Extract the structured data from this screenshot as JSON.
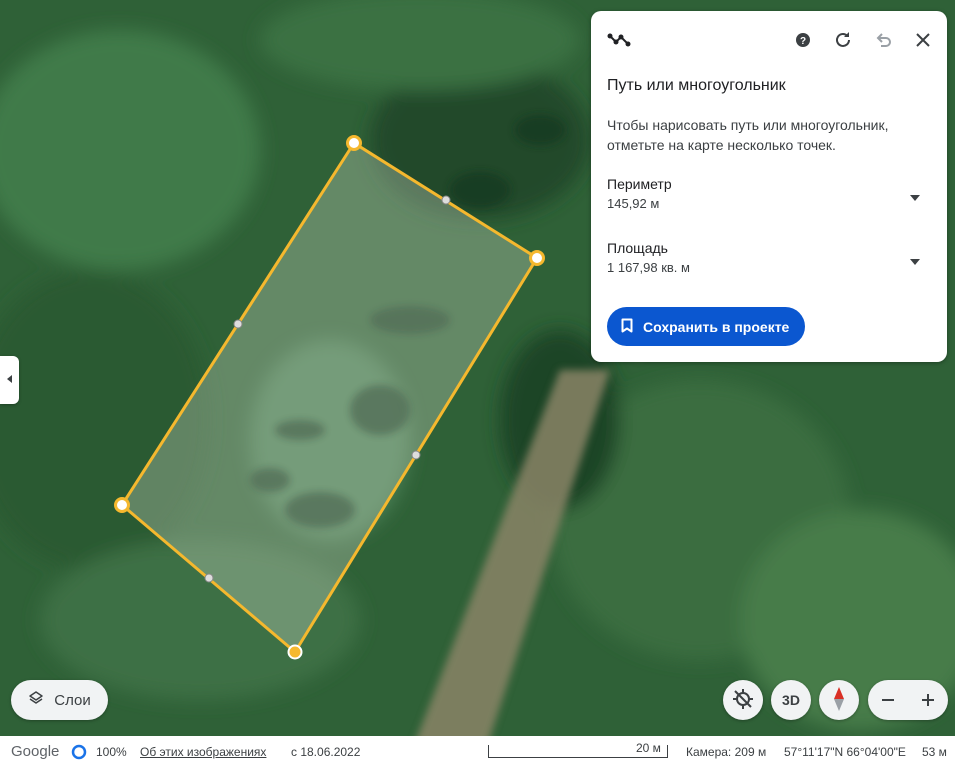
{
  "panel": {
    "title": "Путь или многоугольник",
    "hint": "Чтобы нарисовать путь или многоугольник, отметьте на карте несколько точек.",
    "perimeter": {
      "label": "Периметр",
      "value": "145,92 м"
    },
    "area": {
      "label": "Площадь",
      "value": "1 167,98 кв. м"
    },
    "save_label": "Сохранить в проекте",
    "icons": [
      "path-tool-icon",
      "help-icon",
      "refresh-icon",
      "undo-icon",
      "close-icon"
    ]
  },
  "controls": {
    "layers_label": "Слои",
    "three_d_label": "3D"
  },
  "status": {
    "logo": "Google",
    "zoom": "100%",
    "about_link": "Об этих изображениях",
    "date": "с 18.06.2022",
    "scale": "20 м",
    "camera": "Камера: 209 м",
    "coords": "57°11'17\"N 66°04'00\"E",
    "elevation": "53 м"
  },
  "colors": {
    "accent": "#0b57d0",
    "polygon_stroke": "#f5b82e"
  }
}
